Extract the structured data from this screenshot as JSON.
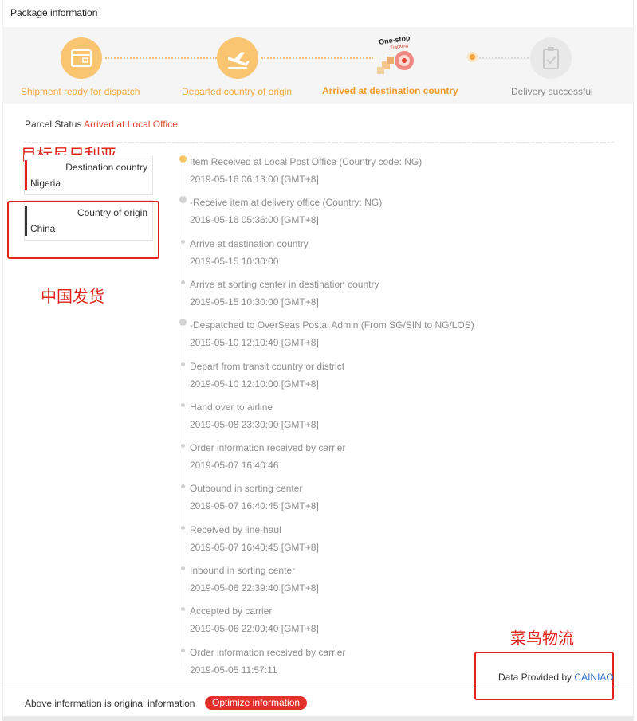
{
  "header": {
    "title": "Package information"
  },
  "progress": {
    "steps": [
      {
        "label": "Shipment ready for dispatch",
        "state": "done",
        "icon": "package-icon"
      },
      {
        "label": "Departed country of origin",
        "state": "done",
        "icon": "airplane-icon"
      },
      {
        "label": "Arrived at destination country",
        "state": "current",
        "icon": "one-stop-tracking-icon",
        "badge_line1": "One-stop",
        "badge_line2": "Tracking"
      },
      {
        "label": "Delivery successful",
        "state": "pending",
        "icon": "clipboard-check-icon"
      }
    ]
  },
  "parcel_status": {
    "label": "Parcel Status",
    "value": "Arrived at Local Office"
  },
  "destination": {
    "label": "Destination country",
    "value": "Nigeria",
    "bar_color": "#e2231a"
  },
  "origin": {
    "label": "Country of origin",
    "value": "China",
    "bar_color": "#333333"
  },
  "annotations": {
    "destination_note": "目标尼日利亚",
    "origin_note": "中国发货",
    "provider_note": "菜鸟物流"
  },
  "timeline": [
    {
      "desc": "Item Received at Local Post Office (Country code: NG)",
      "time": "2019-05-16 06:13:00 [GMT+8]"
    },
    {
      "desc": "-Receive item at delivery office (Country: NG)",
      "time": "2019-05-16 05:36:00 [GMT+8]"
    },
    {
      "desc": "Arrive at destination country",
      "time": "2019-05-15 10:30:00"
    },
    {
      "desc": "Arrive at sorting center in destination country",
      "time": "2019-05-15 10:30:00 [GMT+8]"
    },
    {
      "desc": "-Despatched to OverSeas Postal Admin (From SG/SIN to NG/LOS)",
      "time": "2019-05-10 12:10:49 [GMT+8]"
    },
    {
      "desc": "Depart from transit country or district",
      "time": "2019-05-10 12:10:00 [GMT+8]"
    },
    {
      "desc": "Hand over to airline",
      "time": "2019-05-08 23:30:00 [GMT+8]"
    },
    {
      "desc": "Order information received by carrier",
      "time": "2019-05-07 16:40:46"
    },
    {
      "desc": "Outbound in sorting center",
      "time": "2019-05-07 16:40:45 [GMT+8]"
    },
    {
      "desc": "Received by line-haul",
      "time": "2019-05-07 16:40:45 [GMT+8]"
    },
    {
      "desc": "Inbound in sorting center",
      "time": "2019-05-06 22:39:40 [GMT+8]"
    },
    {
      "desc": "Accepted by carrier",
      "time": "2019-05-06 22:09:40 [GMT+8]"
    },
    {
      "desc": "Order information received by carrier",
      "time": "2019-05-05 11:57:11"
    }
  ],
  "provider": {
    "label": "Data Provided by",
    "name": "CAINIAO"
  },
  "footer": {
    "note": "Above information is original information",
    "button": "Optimize information"
  },
  "colors": {
    "accent_orange": "#f9c571",
    "accent_red": "#e2302a",
    "link_blue": "#2f6fc7"
  }
}
